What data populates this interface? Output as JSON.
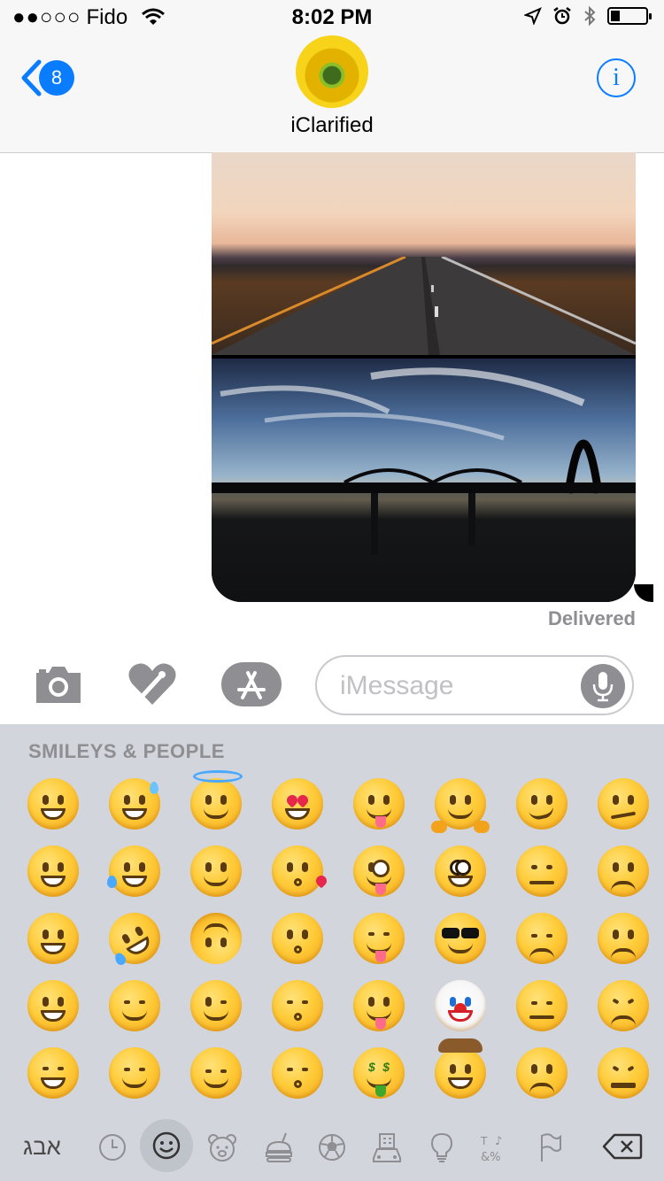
{
  "status_bar": {
    "signal_dots": "●●○○○",
    "carrier": "Fido",
    "time": "8:02 PM",
    "battery_level": 0.25
  },
  "nav": {
    "back_badge": "8",
    "contact_name": "iClarified",
    "info_symbol": "i"
  },
  "conversation": {
    "status": "Delivered"
  },
  "compose": {
    "placeholder": "iMessage"
  },
  "keyboard": {
    "category_title": "SMILEYS & PEOPLE",
    "emoji_rows": [
      [
        "😀",
        "😅",
        "😇",
        "😍",
        "😋",
        "🤗",
        "😏",
        "😕"
      ],
      [
        "😃",
        "😂",
        "🙂",
        "😘",
        "😜",
        "🤓",
        "😒",
        "🙁"
      ],
      [
        "😄",
        "🤣",
        "🙃",
        "😗",
        "😝",
        "😎",
        "😞",
        "☹️"
      ],
      [
        "😁",
        "☺️",
        "😉",
        "😙",
        "😛",
        "🤡",
        "😔",
        "😣"
      ],
      [
        "😆",
        "😊",
        "😌",
        "😚",
        "🤑",
        "🤠",
        "😟",
        "😖"
      ]
    ],
    "language_key": "אבג",
    "category_icons": [
      "clock-icon",
      "smiley-icon",
      "bear-icon",
      "food-icon",
      "ball-icon",
      "building-icon",
      "bulb-icon",
      "symbols-icon",
      "flag-icon"
    ],
    "selected_category": "smiley-icon"
  },
  "colors": {
    "accent": "#0a7cff",
    "keyboard_bg": "#d2d5db",
    "bar_bg": "#f7f7f7",
    "muted": "#8e8e93"
  }
}
